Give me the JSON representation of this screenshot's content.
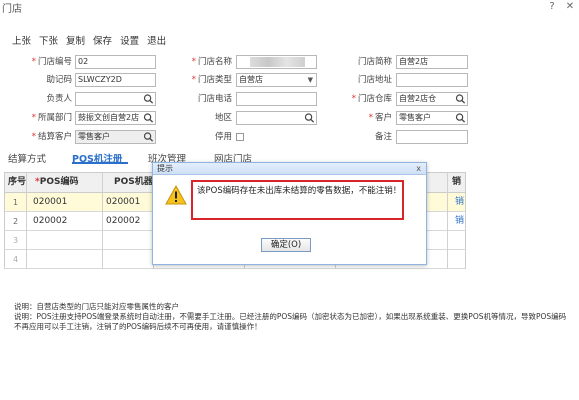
{
  "window": {
    "title": "门店",
    "help_glyph": "?",
    "close_glyph": "✕"
  },
  "toolbar": [
    "上张",
    "下张",
    "复制",
    "保存",
    "设置",
    "退出"
  ],
  "form": {
    "store_code_label": "门店编号",
    "store_code_value": "02",
    "store_name_label": "门店名称",
    "store_short_label": "门店简称",
    "store_short_value": "自营2店",
    "mnemonic_label": "助记码",
    "mnemonic_value": "SLWCZY2D",
    "store_type_label": "门店类型",
    "store_type_value": "自营店",
    "store_address_label": "门店地址",
    "manager_label": "负责人",
    "store_phone_label": "门店电话",
    "warehouse_label": "门店仓库",
    "warehouse_value": "自营2店仓",
    "department_label": "所属部门",
    "department_value": "鼓振文创自营2店",
    "region_label": "地区",
    "customer_label": "客户",
    "customer_value": "零售客户",
    "settle_customer_label": "结算客户",
    "settle_customer_value": "零售客户",
    "disabled_label": "停用",
    "remark_label": "备注"
  },
  "tabs": [
    "结算方式",
    "POS机注册",
    "班次管理",
    "网店门店"
  ],
  "grid": {
    "headers": [
      "序号",
      "POS编码",
      "POS机器",
      "",
      "",
      "销"
    ],
    "rows": [
      {
        "num": "1",
        "code": "020001",
        "machine": "020001",
        "tail": "销"
      },
      {
        "num": "2",
        "code": "020002",
        "machine": "020002",
        "tail": "销"
      },
      {
        "num": "3",
        "code": "",
        "machine": "",
        "tail": ""
      },
      {
        "num": "4",
        "code": "",
        "machine": "",
        "tail": ""
      }
    ]
  },
  "notes": {
    "line1": "说明：自营店类型的门店只能对应零售属性的客户",
    "line2": "说明：POS注册支持POS端登录系统时自动注册，不需要手工注册。已经注册的POS编码（加密状态为已加密），如果出现系统重装、更换POS机等情况，导致POS编码不再应用可以手工注销，注销了的POS编码后续不可再使用，请谨慎操作！"
  },
  "dialog": {
    "title": "提示",
    "close": "x",
    "message": "该POS编码存在未出库未结算的零售数据，不能注销！",
    "ok_label": "确定(O)"
  }
}
